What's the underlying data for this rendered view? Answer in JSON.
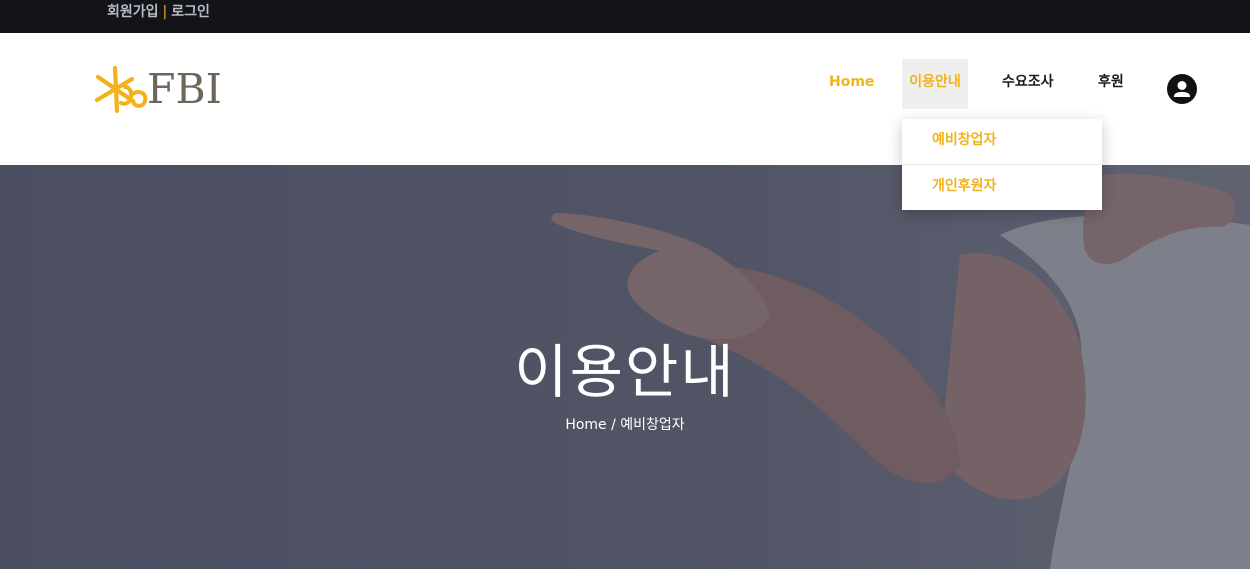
{
  "topbar": {
    "signup_label": "회원가입",
    "separator": "|",
    "login_label": "로그인"
  },
  "logo": {
    "text": "FBI",
    "icon": "kb-star-logo-icon",
    "brand_color": "#f3b21a"
  },
  "nav": {
    "items": [
      {
        "label": "Home"
      },
      {
        "label": "이용안내"
      },
      {
        "label": "수요조사"
      },
      {
        "label": "후원"
      }
    ],
    "user_icon": "user-icon",
    "accent_color": "#f3b21a"
  },
  "dropdown": {
    "items": [
      {
        "label": "예비창업자"
      },
      {
        "label": "개인후원자"
      }
    ]
  },
  "hero": {
    "title": "이용안내",
    "breadcrumb": {
      "home": "Home",
      "separator": " / ",
      "current": "예비창업자"
    }
  }
}
